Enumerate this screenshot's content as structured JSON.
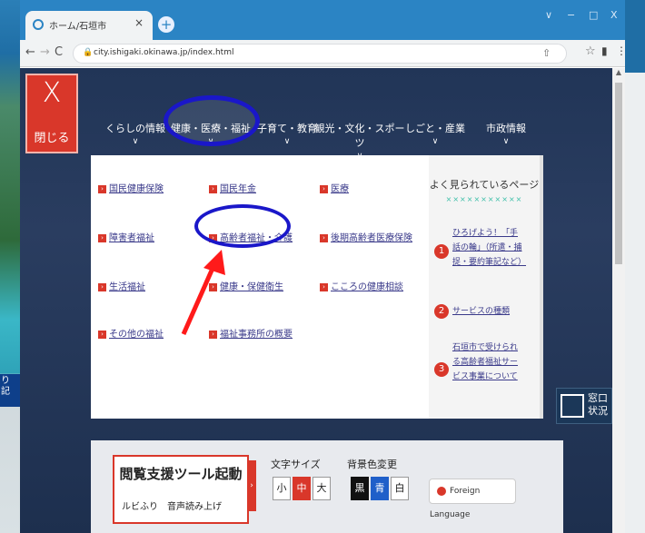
{
  "browser": {
    "tab_title": "ホーム/石垣市",
    "tab_close": "×",
    "new_tab": "+",
    "url": "city.ishigaki.okinawa.jp/index.html",
    "window_controls": [
      "∨",
      "−",
      "□",
      "X"
    ]
  },
  "background": {
    "left_sign": "り 記",
    "right_sign": "窓口\n状況"
  },
  "site": {
    "close_menu": {
      "icon": "X",
      "label": "閉じる"
    },
    "global_nav": [
      {
        "label": "くらしの情報"
      },
      {
        "label": "健康・医療・福祉"
      },
      {
        "label": "子育て・教育"
      },
      {
        "label": "観光・文化・スポーツ"
      },
      {
        "label": "しごと・産業"
      },
      {
        "label": "市政情報"
      }
    ],
    "megamenu": {
      "items": [
        "国民健康保険",
        "国民年金",
        "医療",
        "障害者福祉",
        "高齢者福祉・介護",
        "後期高齢者医療保険",
        "生活福祉",
        "健康・保健衛生",
        "こころの健康相談",
        "その他の福祉",
        "福祉事務所の概要"
      ],
      "popular": {
        "title": "よく見られているページ",
        "decoration": "×××××××××××",
        "entries": [
          {
            "rank": "1",
            "text": "ひろげよう！「手話の輪」（所遣・捕捉・要約筆記など）"
          },
          {
            "rank": "2",
            "text": "サービスの種類"
          },
          {
            "rank": "3",
            "text": "石垣市で受けられる高齢者福祉サービス事業について"
          }
        ]
      }
    },
    "accessibility": {
      "reader_title": "閲覧支援ツール起動",
      "reader_sub": "ルビふり　音声読み上げ",
      "font_size_label": "文字サイズ",
      "font_sizes": [
        "小",
        "中",
        "大"
      ],
      "bg_color_label": "背景色変更",
      "bg_colors": [
        "黒",
        "青",
        "白"
      ],
      "foreign_language": "Foreign Language"
    }
  },
  "colors": {
    "accent_red": "#d9372a",
    "annotation_blue": "#1a17c9",
    "titlebar": "#2b84c4"
  }
}
